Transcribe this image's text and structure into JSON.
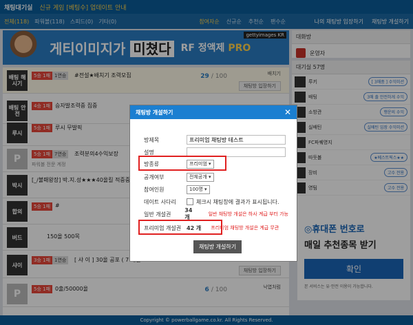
{
  "topbar": {
    "brand": "채팅대기실",
    "notice": "신규 게임 [베팅수] 업데이트 안내"
  },
  "navbar": {
    "tabs": [
      "전체(118)",
      "파워볼(118)",
      "스피드(0)",
      "기타(0)"
    ],
    "sorts": [
      "참여자순",
      "신규순",
      "추천순",
      "팬수순"
    ],
    "links": [
      "나의 채팅방 입장하기",
      "채팅방 개설하기"
    ]
  },
  "banner": {
    "tag": "gettyimages KR",
    "main_text": "게티이미지가",
    "highlight": "미쳤다",
    "product_prefix": "RF 정액제",
    "product_suffix": "PRO"
  },
  "rows": [
    {
      "thumb": "배팅 해시기",
      "level": "5승 1패",
      "count": "1연승",
      "title": "#전설★배치기 조력모집",
      "sub": "",
      "users": "29",
      "max": "100",
      "host": "배치기",
      "enter": "채팅방 입장하기"
    },
    {
      "thumb": "배팅 안전",
      "level": "4승 1패",
      "count": "",
      "title": "승자발조력중 집중",
      "sub": "",
      "users": "",
      "max": "",
      "host": "",
      "enter": ""
    },
    {
      "thumb": "루시",
      "level": "5승 1패",
      "count": "",
      "title": "루시 무발픽",
      "sub": "",
      "users": "",
      "max": "",
      "host": "",
      "enter": ""
    },
    {
      "thumb": "P",
      "level": "5승 1패",
      "count": "7연승",
      "title": "조력분의4수익보장",
      "sub": "파워볼 전문 계정",
      "users": "",
      "max": "",
      "host": "",
      "enter": ""
    },
    {
      "thumb": "박시",
      "level": "",
      "count": "",
      "title": "[_/불패왕장] 박.지.성★★★40올킬 적중중★",
      "sub": "",
      "users": "",
      "max": "",
      "host": "",
      "enter": ""
    },
    {
      "thumb": "합의",
      "level": "5승 1패",
      "count": "",
      "title": "#",
      "sub": "",
      "users": "",
      "max": "",
      "host": "",
      "enter": ""
    },
    {
      "thumb": "버드",
      "level": "",
      "count": "",
      "title": "150올 500목",
      "sub": "",
      "users": "",
      "max": "",
      "host": "",
      "enter": ""
    },
    {
      "thumb": "샤이",
      "level": "3승 1패",
      "count": "1연승",
      "title": "[ 샤 이 ] 30올 공포 ( 7 매일...",
      "sub": "",
      "users": "",
      "max": "",
      "host": "",
      "enter": "채팅방 입장하기"
    },
    {
      "thumb": "P",
      "level": "5승 1패",
      "count": "",
      "title": "0출/50000올",
      "sub": "",
      "users": "6",
      "max": "100",
      "host": "낙엽처럼",
      "enter": ""
    }
  ],
  "side": {
    "admin_head": "대화방",
    "admin_name": "운영자",
    "waiting_head": "대기실 57명",
    "waiting": [
      {
        "name": "루키",
        "status": "[ 3매중 ] 수익미션"
      },
      {
        "name": "배팅",
        "status": "3매 출 안전하게 수익"
      },
      {
        "name": "소방관",
        "status": "행운의 수익"
      },
      {
        "name": "실배틴",
        "status": "실배틴 입장 수익미션"
      },
      {
        "name": "FC파퀘영지",
        "status": ""
      },
      {
        "name": "따듯볼",
        "status": "★베스트픽스★★"
      },
      {
        "name": "장비",
        "status": "고수 전용"
      },
      {
        "name": "영팀",
        "status": "고수 전용"
      }
    ]
  },
  "ad": {
    "line1": "◎휴대폰 번호로",
    "line2": "매일 추천종목 받기",
    "button": "확인",
    "note": "본 서비스는 유·안전 이용이 가능합니다."
  },
  "footer": "Copyright © powerballgame.co.kr. All Rights Reserved.",
  "modal": {
    "title": "채팅방 개설하기",
    "close": "✕",
    "fields": {
      "room_name_label": "방제목",
      "room_name_value": "프리미엄 채팅방 테스트",
      "desc_label": "설명",
      "desc_value": "",
      "type_label": "방종류",
      "type_value": "프리미엄 ▾",
      "visibility_label": "공개여부",
      "visibility_value": "전체공개 ▾",
      "max_label": "참여인원",
      "max_value": "100명 ▾",
      "data_label": "데이트 사다리",
      "data_text": "체크시 채팅창에 결과가 표시됩니다.",
      "normal_label": "일반 개설권",
      "normal_value": "34 개",
      "normal_warn": "일반 채팅방 개설은 하사 계급 부터 가능",
      "premium_label": "프리미엄 개설권",
      "premium_value": "42 개",
      "premium_warn": "프리미엄 채팅방 개설은 계급 무관"
    },
    "submit": "채팅방 개설하기"
  }
}
